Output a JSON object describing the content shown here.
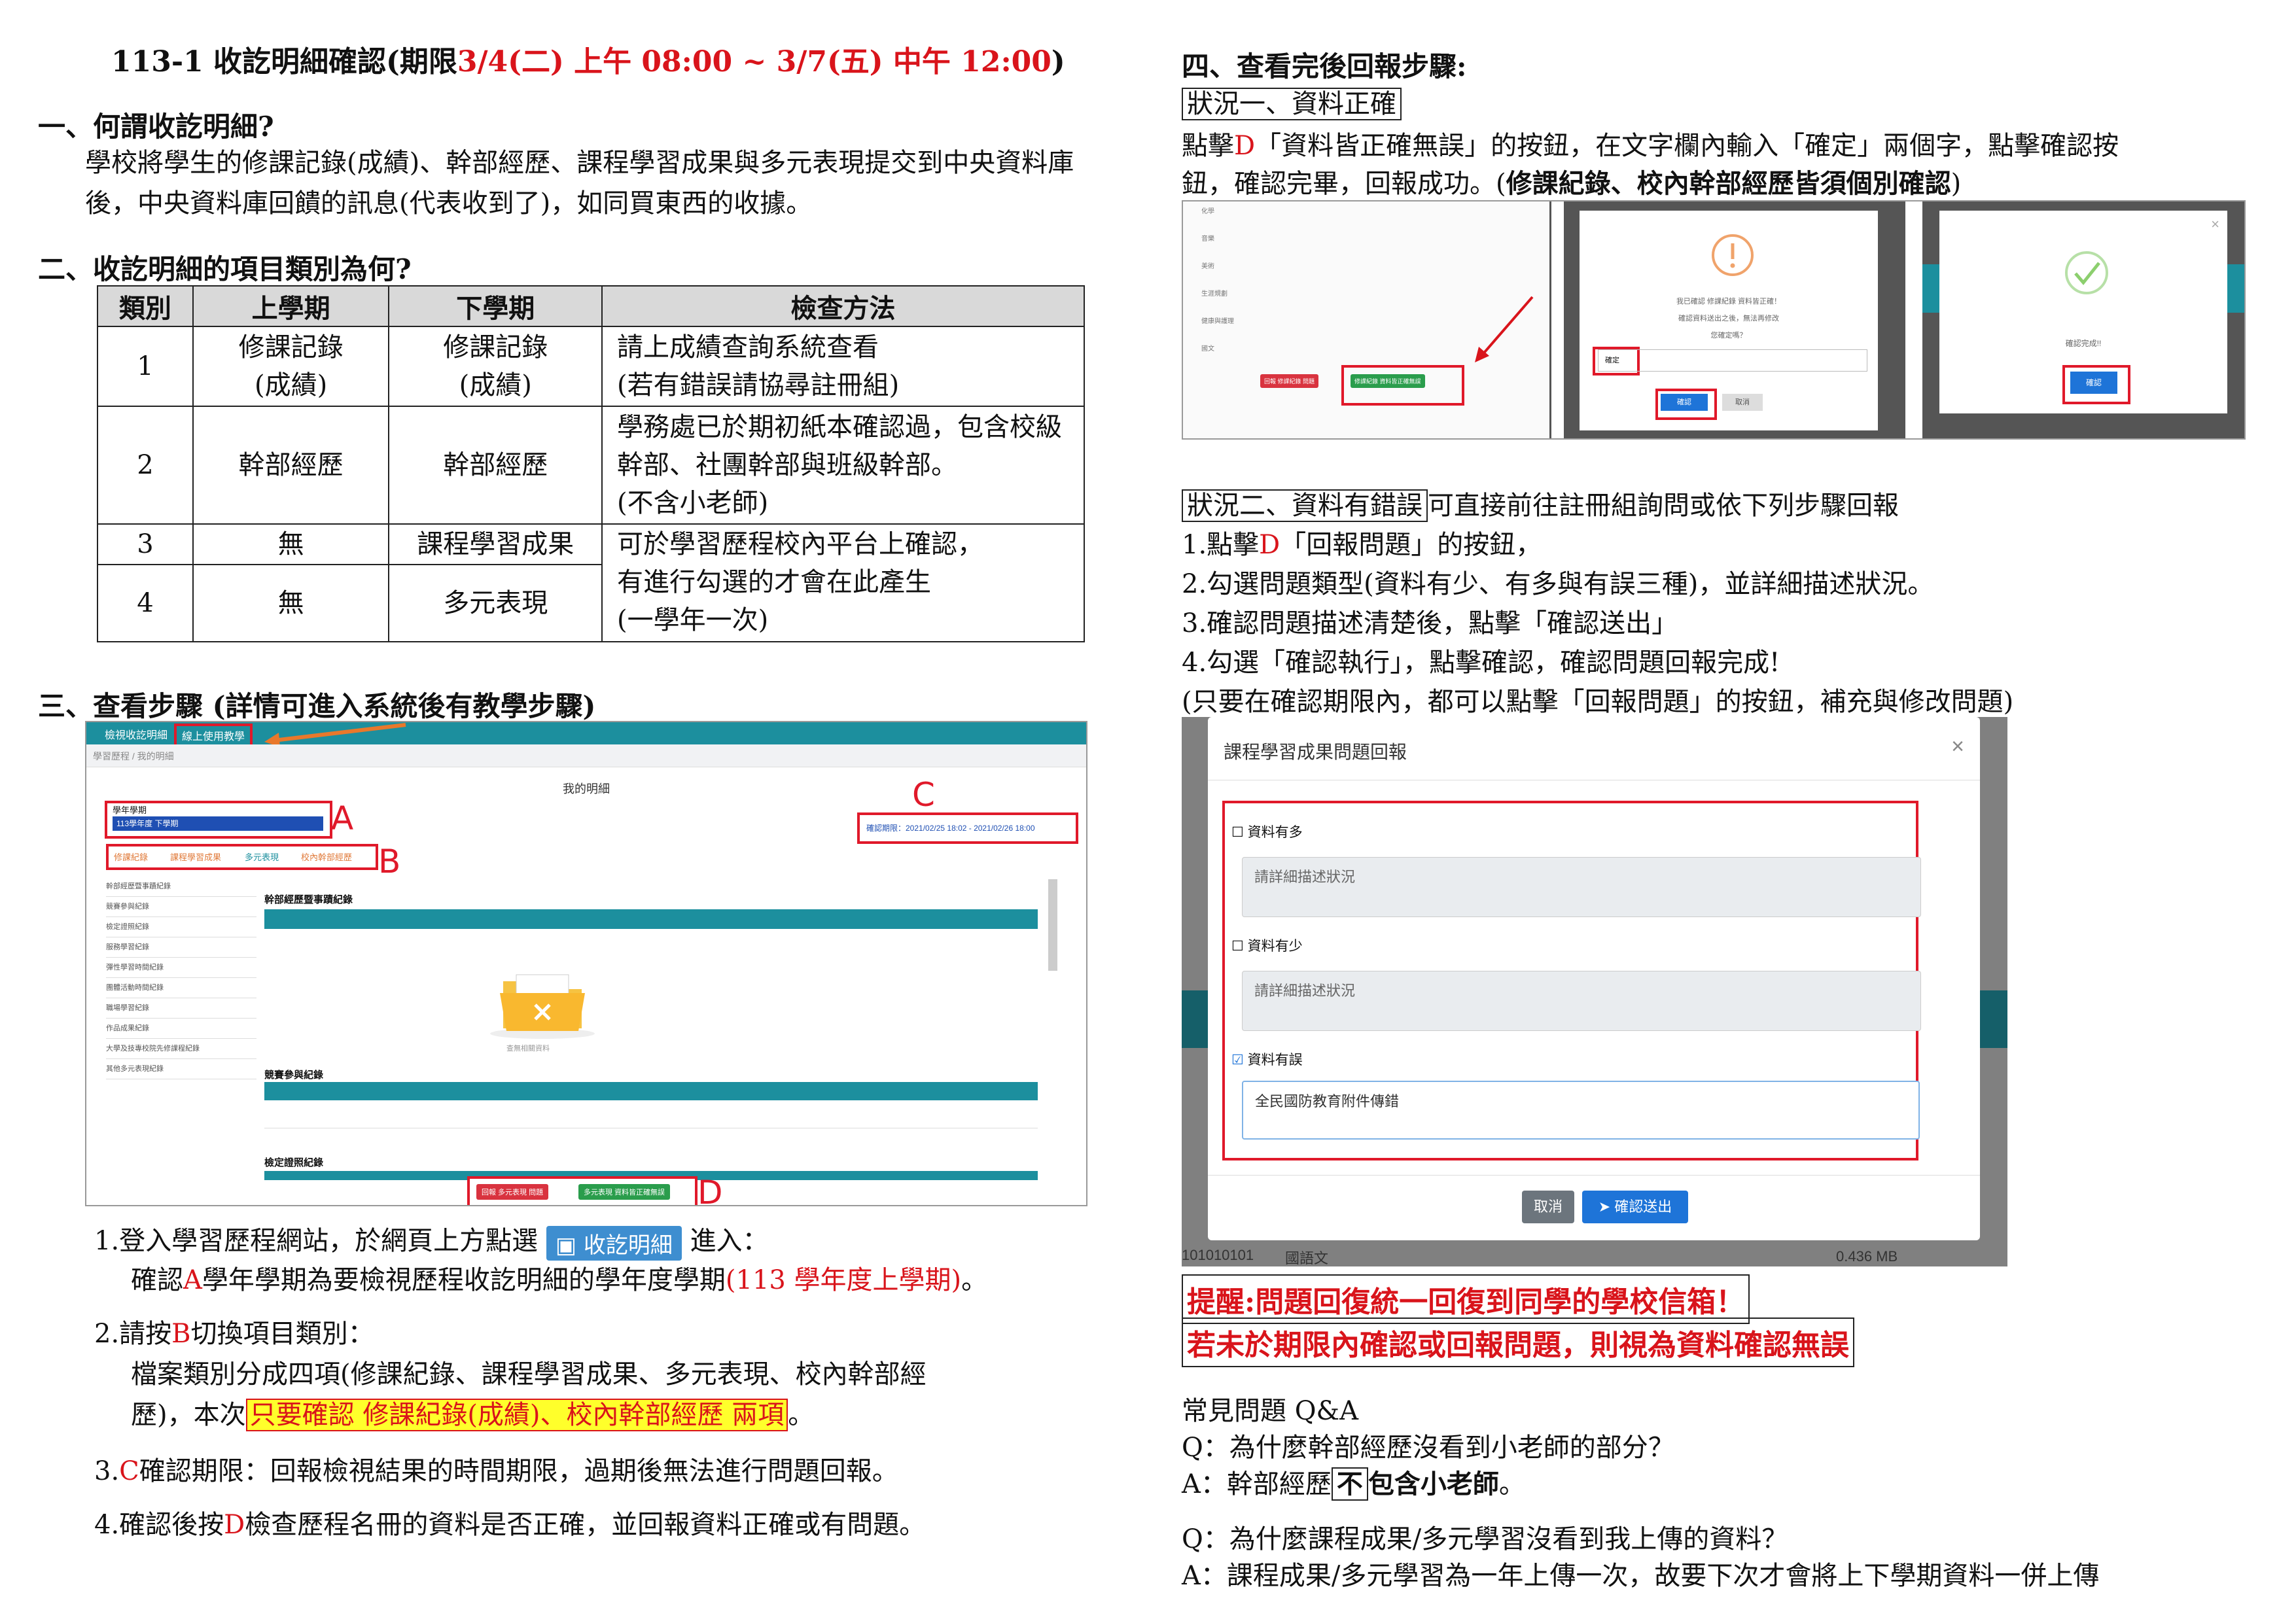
{
  "title": {
    "prefix": "113-1 收訖明細確認(期限",
    "deadline": "3/4(二) 上午 08:00 ~ 3/7(五) 中午 12:00",
    "suffix": ")"
  },
  "section1": {
    "heading": "一、何謂收訖明細?",
    "body": "學校將學生的修課記錄(成績)、幹部經歷、課程學習成果與多元表現提交到中央資料庫後，中央資料庫回饋的訊息(代表收到了)，如同買東西的收據。"
  },
  "section2": {
    "heading": "二、收訖明細的項目類別為何?",
    "table": {
      "headers": [
        "類別",
        "上學期",
        "下學期",
        "檢查方法"
      ],
      "rows": [
        {
          "no": "1",
          "first": "修課記錄\n(成績)",
          "second": "修課記錄\n(成績)",
          "method": "請上成績查詢系統查看\n(若有錯誤請協尋註冊組)"
        },
        {
          "no": "2",
          "first": "幹部經歷",
          "second": "幹部經歷",
          "method": "學務處已於期初紙本確認過，包含校級幹部、社團幹部與班級幹部。\n(不含小老師)"
        },
        {
          "no": "3",
          "first": "無",
          "second": "課程學習成果",
          "method": "可於學習歷程校內平台上確認，\n有進行勾選的才會在此產生\n(一學年一次)"
        },
        {
          "no": "4",
          "first": "無",
          "second": "多元表現",
          "method": ""
        }
      ]
    }
  },
  "section3": {
    "heading": "三、查看步驟 (詳情可進入系統後有教學步驟)",
    "screenshot": {
      "nav_tab1": "檢視收訖明細",
      "nav_tab2": "線上使用教學",
      "breadcrumb": "學習歷程 / 我的明細",
      "page_title": "我的明細",
      "term_label": "學年學期",
      "term_value": "113學年度 下學期",
      "deadline_text": "確認期限：2021/02/25 18:02 - 2021/02/26 18:00",
      "tabs": [
        "修課紀錄",
        "課程學習成果",
        "多元表現",
        "校內幹部經歷"
      ],
      "side_items": [
        "幹部經歷暨事蹟紀錄",
        "競賽參與紀錄",
        "檢定證照紀錄",
        "服務學習紀錄",
        "彈性學習時間紀錄",
        "團體活動時間紀錄",
        "職場學習紀錄",
        "作品成果紀錄",
        "大學及技專校院先修課程紀錄",
        "其他多元表現紀錄"
      ],
      "section_a": "幹部經歷暨事蹟紀錄",
      "empty_text": "查無相關資料",
      "section_b": "競賽參與紀錄",
      "section_c": "檢定證照紀錄",
      "btn_report": "回報 多元表現 問題",
      "btn_ok": "多元表現 資料皆正確無誤",
      "markers": [
        "A",
        "B",
        "C",
        "D"
      ]
    },
    "steps": {
      "s1_a": "1.登入學習歷程網站，於網頁上方點選",
      "s1_btn": "收訖明細",
      "s1_b": "進入：",
      "s1_c": "確認",
      "s1_marker": "A",
      "s1_d": "學年學期為要檢視歷程收訖明細的學年度學期",
      "s1_red": "(113 學年度上學期)",
      "s1_e": "。",
      "s2_a": "2.請按",
      "s2_marker": "B",
      "s2_b": "切換項目類別：",
      "s2_c": "檔案類別分成四項(修課紀錄、課程學習成果、多元表現、校內幹部經",
      "s2_d": "歷)，本次",
      "s2_hl": "只要確認 修課紀錄(成績)、校內幹部經歷 兩項",
      "s2_e": "。",
      "s3_a": "3.",
      "s3_marker": "C",
      "s3_b": "確認期限：回報檢視結果的時間期限，過期後無法進行問題回報。",
      "s4_a": "4.確認後按",
      "s4_marker": "D",
      "s4_b": "檢查歷程名冊的資料是否正確，並回報資料正確或有問題。"
    }
  },
  "section4": {
    "heading": "四、查看完後回報步驟:",
    "case1": {
      "label": "狀況一、資料正確",
      "l1_a": "點擊",
      "l1_marker": "D",
      "l1_b": "「資料皆正確無誤」的按鈕，在文字欄內輸入「確定」兩個字，點擊確認按",
      "l2_a": "鈕，確認完畢，回報成功。(",
      "l2_bold": "修課紀錄、校內幹部經歷皆須個別確認",
      "l2_b": ")",
      "shot1_subjects": [
        "化學",
        "音樂",
        "美術",
        "生涯規劃",
        "健康與護理",
        "國文"
      ],
      "shot1_btn_report": "回報 修課紀錄 問題",
      "shot1_btn_ok": "修課紀錄 資料皆正確無誤",
      "shot2_text": "我已確認 修課紀錄 資料皆正確！\n確認資料送出之後，無法再修改\n您確定嗎？",
      "shot2_input": "確定",
      "shot2_confirm": "確認",
      "shot2_cancel": "取消",
      "shot3_text": "確認完成!!",
      "shot3_btn": "確認"
    },
    "case2": {
      "label": "狀況二、資料有錯誤",
      "intro": "可直接前往註冊組詢問或依下列步驟回報",
      "step1_a": "1.點擊",
      "step1_marker": "D",
      "step1_b": "「回報問題」的按鈕，",
      "step2": "2.勾選問題類型(資料有少、有多與有誤三種)，並詳細描述狀況。",
      "step3": "3.確認問題描述清楚後，點擊「確認送出」",
      "step4": "4.勾選「確認執行」，點擊確認，確認問題回報完成!",
      "note": "(只要在確認期限內，都可以點擊「回報問題」的按鈕，補充與修改問題)"
    },
    "dialog": {
      "title": "課程學習成果問題回報",
      "close": "×",
      "opt1": "資料有多",
      "opt2": "資料有少",
      "opt3": "資料有誤",
      "placeholder": "請詳細描述狀況",
      "opt3_value": "全民國防教育附件傳錯",
      "cancel": "取消",
      "submit": "確認送出",
      "bg_code": "101010101",
      "bg_subject": "國語文",
      "bg_size": "0.436 MB"
    },
    "warning1": "提醒:問題回復統一回復到同學的學校信箱！",
    "warning2": "若未於期限內確認或回報問題，則視為資料確認無誤"
  },
  "faq": {
    "heading": "常見問題 Q&A",
    "q1": "Q：為什麼幹部經歷沒看到小老師的部分？",
    "a1_a": "A：幹部經歷",
    "a1_box": "不",
    "a1_b": "包含小老師",
    "a1_c": "。",
    "q2": "Q：為什麼課程成果/多元學習沒看到我上傳的資料？",
    "a2": "A：課程成果/多元學習為一年上傳一次，故要下次才會將上下學期資料一併上傳"
  },
  "colors": {
    "red": "#d9141b",
    "highlight": "#ffff2b",
    "teal": "#1c8f9e",
    "blue": "#1e74d8"
  }
}
